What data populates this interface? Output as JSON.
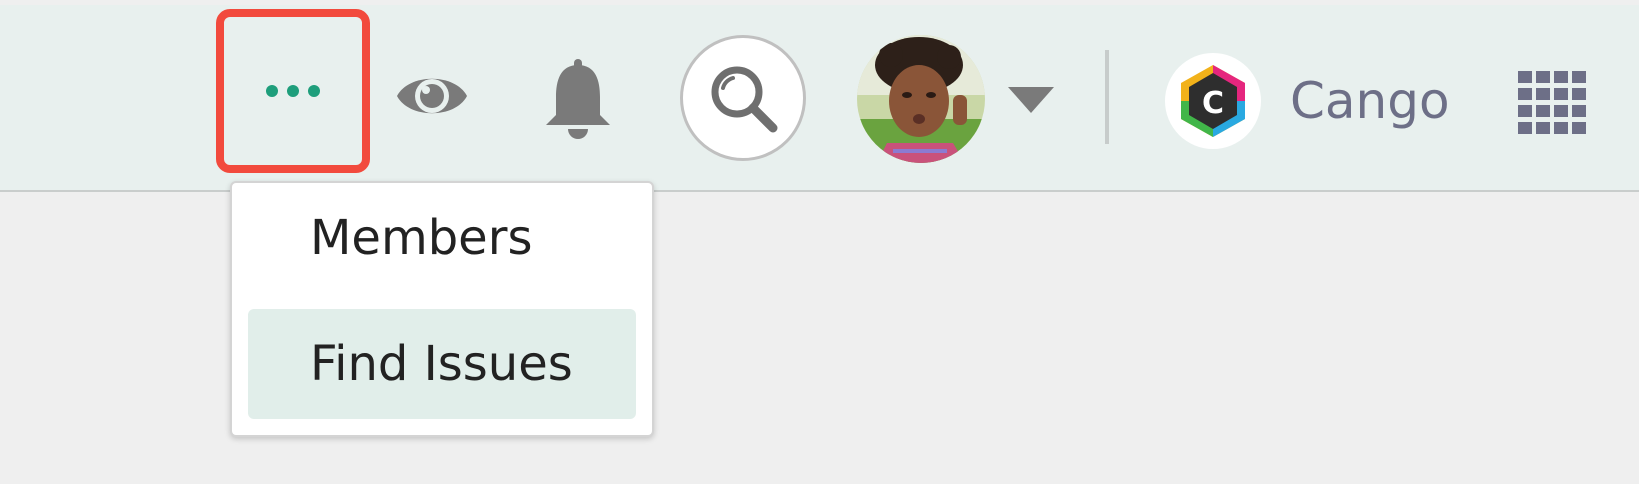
{
  "topbar": {
    "more_button": {
      "icon": "ellipsis-icon",
      "highlighted": true,
      "highlight_color": "#f24a3d",
      "dot_color": "#1e9e7b"
    },
    "watch_icon": "eye-icon",
    "notifications_icon": "bell-icon",
    "search_icon": "search-icon",
    "profile": {
      "avatar": "user-avatar",
      "dropdown_icon": "caret-down-icon"
    },
    "app": {
      "logo_icon": "cango-logo-icon",
      "name": "Cango"
    },
    "apps_icon": "app-grid-icon"
  },
  "more_menu": {
    "items": [
      {
        "label": "Members",
        "highlighted": false
      },
      {
        "label": "Find Issues",
        "highlighted": true
      }
    ],
    "highlight_color": "#e1eeea"
  },
  "colors": {
    "topbar_bg": "#e8f0ee",
    "page_bg": "#efefef",
    "icon_gray": "#7a7a7a",
    "accent_green": "#1e9e7b"
  }
}
